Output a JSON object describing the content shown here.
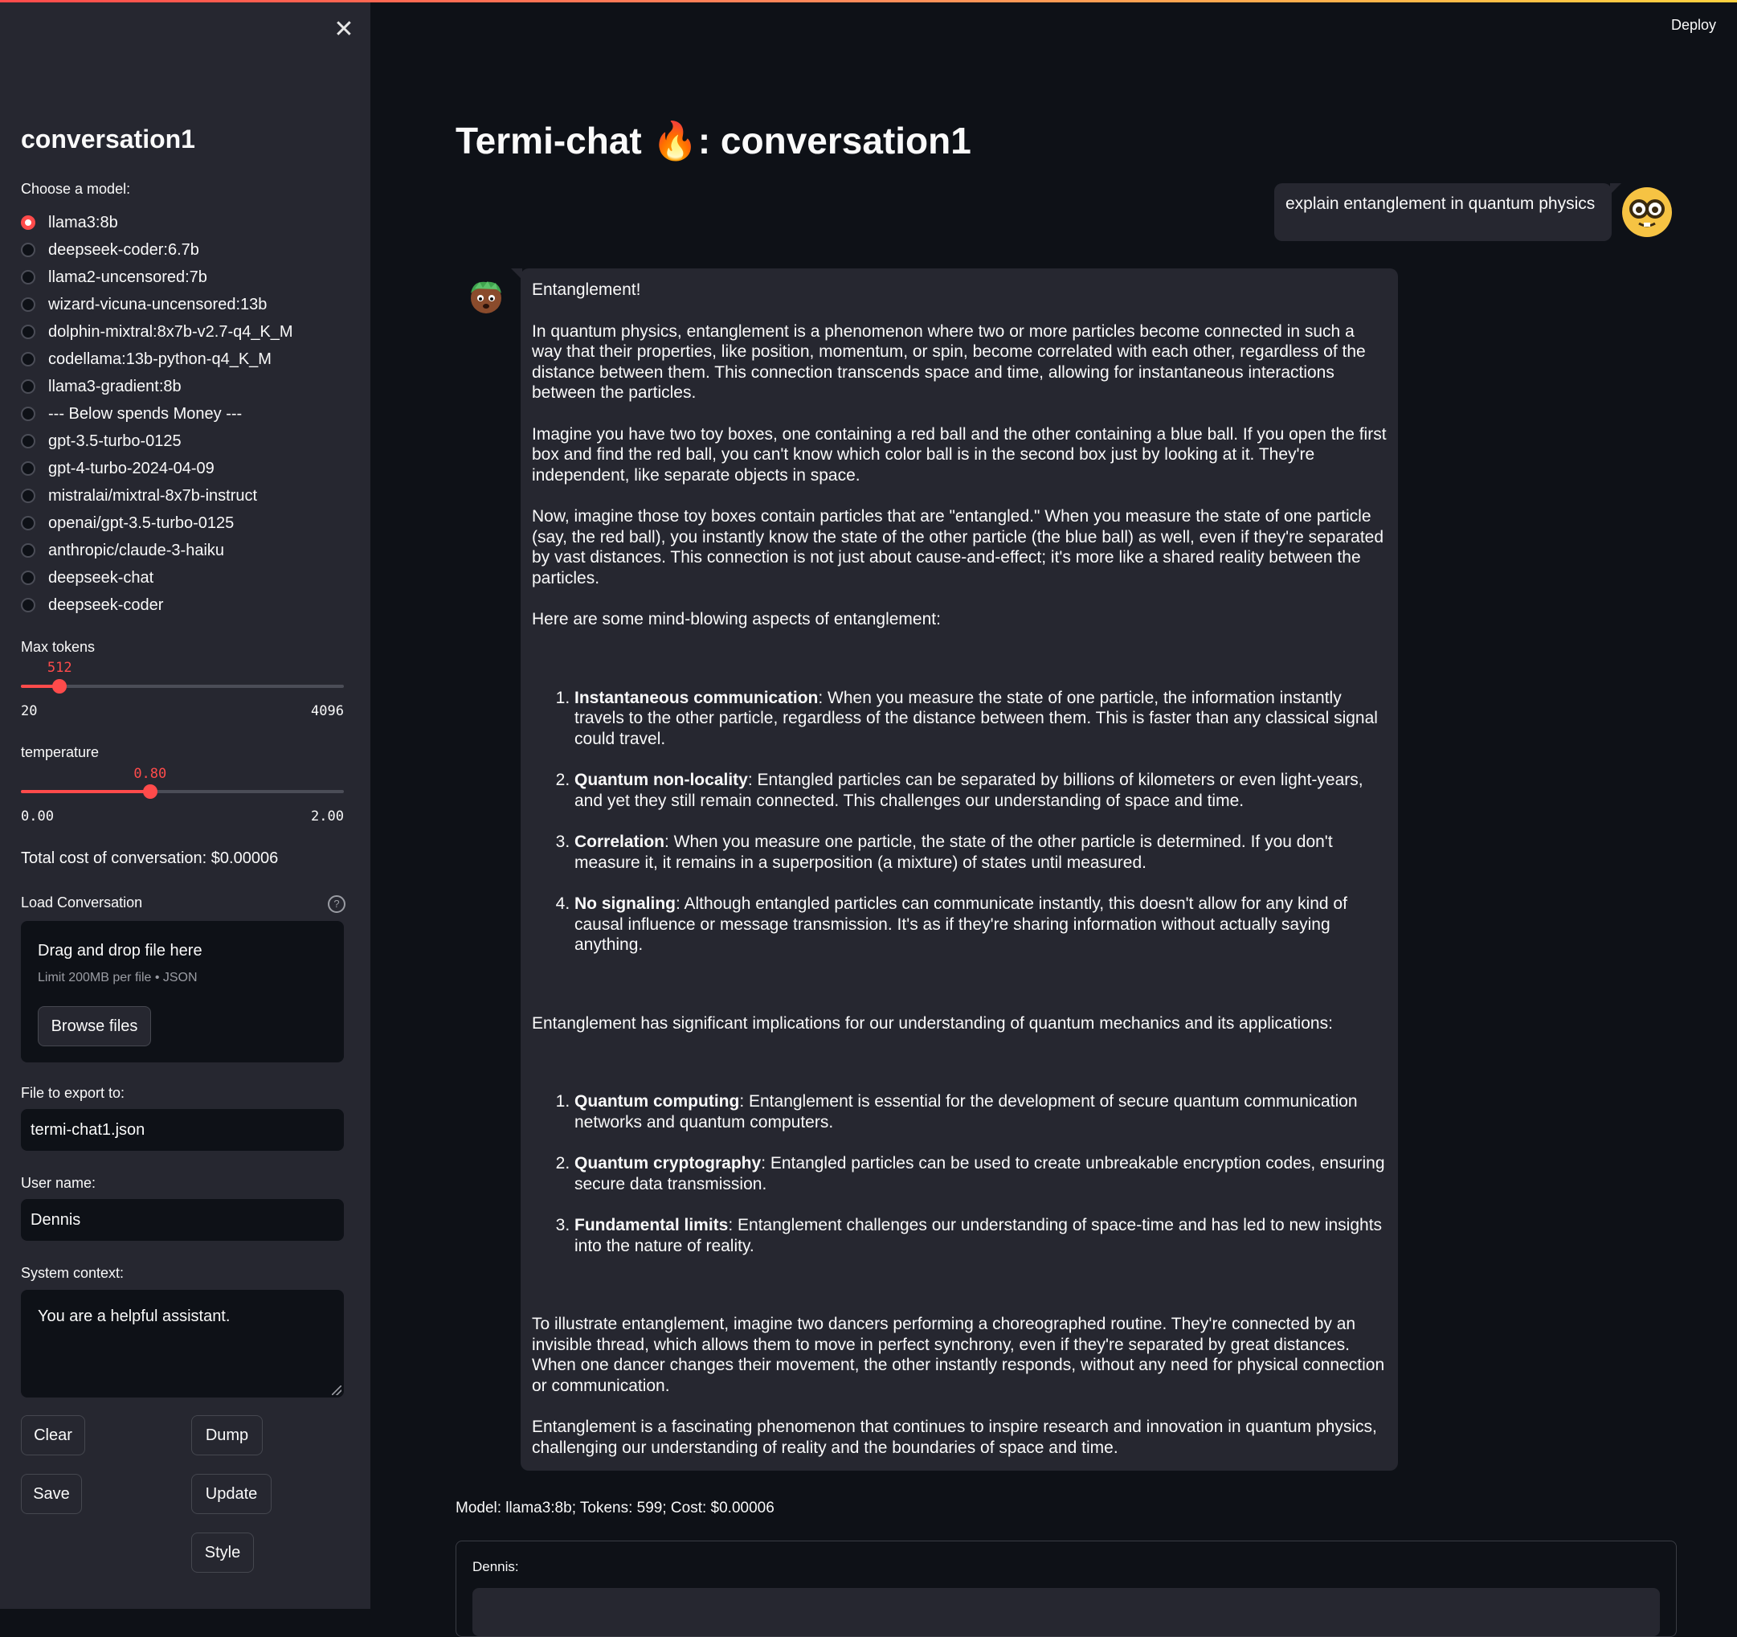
{
  "topbar": {
    "deploy_label": "Deploy"
  },
  "sidebar": {
    "close_glyph": "✕",
    "title": "conversation1",
    "model_label": "Choose a model:",
    "models": [
      "llama3:8b",
      "deepseek-coder:6.7b",
      "llama2-uncensored:7b",
      "wizard-vicuna-uncensored:13b",
      "dolphin-mixtral:8x7b-v2.7-q4_K_M",
      "codellama:13b-python-q4_K_M",
      "llama3-gradient:8b",
      "--- Below spends Money ---",
      "gpt-3.5-turbo-0125",
      "gpt-4-turbo-2024-04-09",
      "mistralai/mixtral-8x7b-instruct",
      "openai/gpt-3.5-turbo-0125",
      "anthropic/claude-3-haiku",
      "deepseek-chat",
      "deepseek-coder"
    ],
    "selected_model": "llama3:8b",
    "max_tokens": {
      "label": "Max tokens",
      "value": "512",
      "min": "20",
      "max": "4096",
      "fraction": 0.12
    },
    "temperature": {
      "label": "temperature",
      "value": "0.80",
      "min": "0.00",
      "max": "2.00",
      "fraction": 0.4
    },
    "total_cost": "Total cost of conversation: $0.00006",
    "load": {
      "label": "Load Conversation",
      "help_icon": "?",
      "drag_text": "Drag and drop file here",
      "limit_text": "Limit 200MB per file • JSON",
      "browse_label": "Browse files"
    },
    "export": {
      "label": "File to export to:",
      "value": "termi-chat1.json"
    },
    "username": {
      "label": "User name:",
      "value": "Dennis"
    },
    "system": {
      "label": "System context:",
      "value": "You are a helpful assistant."
    },
    "buttons": {
      "clear": "Clear",
      "dump": "Dump",
      "save": "Save",
      "update": "Update",
      "style": "Style"
    }
  },
  "main": {
    "title_prefix": "Termi-chat ",
    "title_emoji": "🔥",
    "title_suffix": ": conversation1",
    "user_message": "explain entanglement in quantum physics",
    "assistant": {
      "p1": "Entanglement!",
      "p2": "In quantum physics, entanglement is a phenomenon where two or more particles become connected in such a way that their properties, like position, momentum, or spin, become correlated with each other, regardless of the distance between them. This connection transcends space and time, allowing for instantaneous interactions between the particles.",
      "p3": "Imagine you have two toy boxes, one containing a red ball and the other containing a blue ball. If you open the first box and find the red ball, you can't know which color ball is in the second box just by looking at it. They're independent, like separate objects in space.",
      "p4": "Now, imagine those toy boxes contain particles that are \"entangled.\" When you measure the state of one particle (say, the red ball), you instantly know the state of the other particle (the blue ball) as well, even if they're separated by vast distances. This connection is not just about cause-and-effect; it's more like a shared reality between the particles.",
      "p5": "Here are some mind-blowing aspects of entanglement:",
      "list1": [
        {
          "b": "Instantaneous communication",
          "t": ": When you measure the state of one particle, the information instantly travels to the other particle, regardless of the distance between them. This is faster than any classical signal could travel."
        },
        {
          "b": "Quantum non-locality",
          "t": ": Entangled particles can be separated by billions of kilometers or even light-years, and yet they still remain connected. This challenges our understanding of space and time."
        },
        {
          "b": "Correlation",
          "t": ": When you measure one particle, the state of the other particle is determined. If you don't measure it, it remains in a superposition (a mixture) of states until measured."
        },
        {
          "b": "No signaling",
          "t": ": Although entangled particles can communicate instantly, this doesn't allow for any kind of causal influence or message transmission. It's as if they're sharing information without actually saying anything."
        }
      ],
      "p6": "Entanglement has significant implications for our understanding of quantum mechanics and its applications:",
      "list2": [
        {
          "b": "Quantum computing",
          "t": ": Entanglement is essential for the development of secure quantum communication networks and quantum computers."
        },
        {
          "b": "Quantum cryptography",
          "t": ": Entangled particles can be used to create unbreakable encryption codes, ensuring secure data transmission."
        },
        {
          "b": "Fundamental limits",
          "t": ": Entanglement challenges our understanding of space-time and has led to new insights into the nature of reality."
        }
      ],
      "p7": "To illustrate entanglement, imagine two dancers performing a choreographed routine. They're connected by an invisible thread, which allows them to move in perfect synchrony, even if they're separated by great distances. When one dancer changes their movement, the other instantly responds, without any need for physical connection or communication.",
      "p8": "Entanglement is a fascinating phenomenon that continues to inspire research and innovation in quantum physics, challenging our understanding of reality and the boundaries of space and time."
    },
    "meta": "Model: llama3:8b; Tokens: 599; Cost: $0.00006",
    "input_label": "Dennis:"
  },
  "icons": {
    "user_avatar": "nerd-face-icon",
    "bot_avatar": "robot-face-icon",
    "close": "close-icon",
    "help": "help-icon"
  },
  "colors": {
    "accent": "#ff4b4b",
    "background": "#0e1117",
    "sidebar": "#262730",
    "bubble": "#262730"
  }
}
